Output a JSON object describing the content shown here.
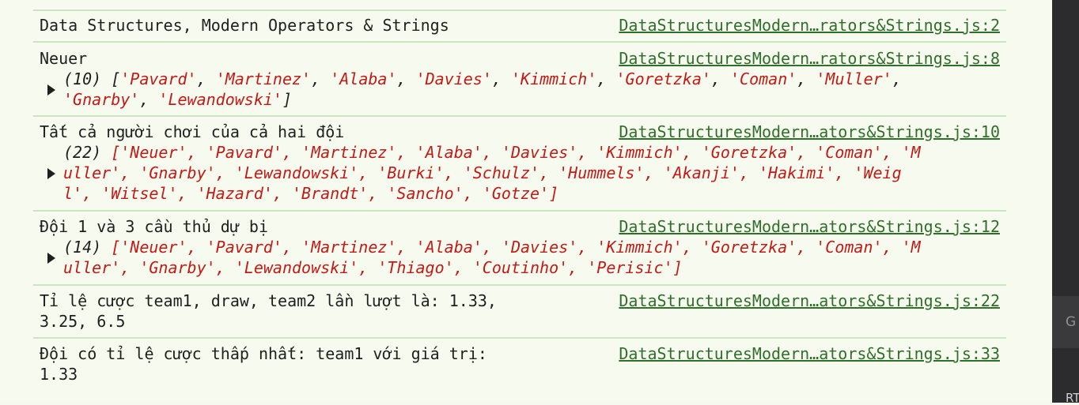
{
  "entries": [
    {
      "text": "Data Structures, Modern Operators & Strings",
      "source": "DataStructuresModern…rators&Strings.js:2"
    },
    {
      "text": "Neuer",
      "source": "DataStructuresModern…rators&Strings.js:8",
      "array": {
        "count": "(10)",
        "lines": [
          [
            "'Pavard'",
            "'Martinez'",
            "'Alaba'",
            "'Davies'",
            "'Kimmich'",
            "'Goretzka'",
            "'Coman'",
            "'Muller'"
          ],
          [
            "'Gnarby'",
            "'Lewandowski'"
          ]
        ]
      }
    },
    {
      "text": "Tất cả người chơi của cả hai đội",
      "source": "DataStructuresModern…ators&Strings.js:10",
      "array": {
        "count": "(22)",
        "line1": "['Neuer', 'Pavard', 'Martinez', 'Alaba', 'Davies', 'Kimmich', 'Goretzka', 'Coman', 'M",
        "line2": "uller', 'Gnarby', 'Lewandowski', 'Burki', 'Schulz', 'Hummels', 'Akanji', 'Hakimi', 'Weig",
        "line3": "l', 'Witsel', 'Hazard', 'Brandt', 'Sancho', 'Gotze']"
      }
    },
    {
      "text": "Đội 1 và 3 cầu thủ dự bị",
      "source": "DataStructuresModern…ators&Strings.js:12",
      "array": {
        "count": "(14)",
        "line1": "['Neuer', 'Pavard', 'Martinez', 'Alaba', 'Davies', 'Kimmich', 'Goretzka', 'Coman', 'M",
        "line2": "uller', 'Gnarby', 'Lewandowski', 'Thiago', 'Coutinho', 'Perisic']"
      }
    },
    {
      "text_line1": "Tỉ lệ cược team1, draw, team2 lần lượt là: 1.33,",
      "text_line2": "3.25, 6.5",
      "source": "DataStructuresModern…ators&Strings.js:22"
    },
    {
      "text_line1": "Đội có tỉ lệ cược thấp nhất: team1 với giá trị:",
      "text_line2": "1.33",
      "source": "DataStructuresModern…ators&Strings.js:33"
    }
  ],
  "side_panel": {
    "label1": "G G",
    "label2": "RT"
  },
  "colors": {
    "background": "#f7faef",
    "string": "#c41a16",
    "link": "#2f6f2a",
    "separator": "#c9e6c0"
  }
}
